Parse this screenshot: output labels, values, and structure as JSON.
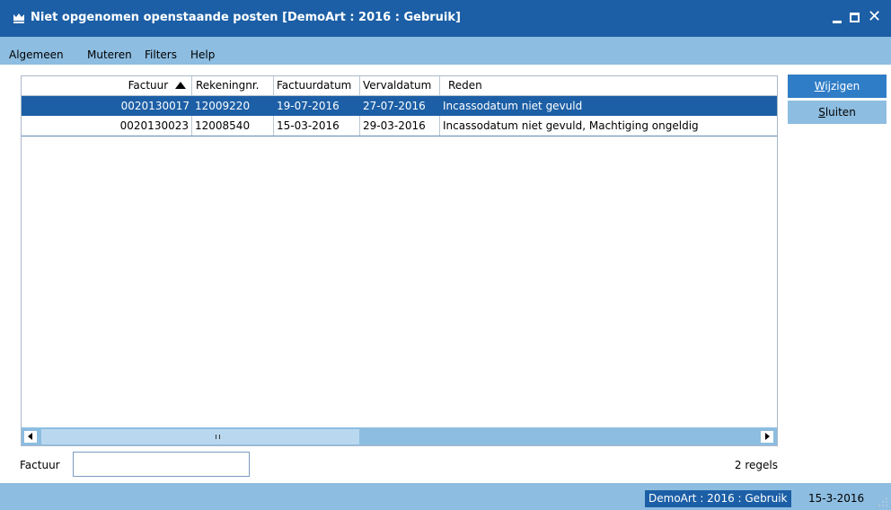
{
  "window": {
    "title": "Niet opgenomen openstaande posten  [DemoArt : 2016 : Gebruik]",
    "controls": [
      "minimize-icon",
      "maximize-icon",
      "close-icon"
    ],
    "close_glyph": "✕"
  },
  "menu": {
    "items": [
      "Algemeen",
      "Muteren",
      "Filters",
      "Help"
    ]
  },
  "grid": {
    "columns": [
      "Factuur",
      "Rekeningnr.",
      "Factuurdatum",
      "Vervaldatum",
      "Reden"
    ],
    "sort_column": "Factuur",
    "sort_direction": "ascending",
    "rows": [
      [
        "0020130017",
        "12009220",
        "19-07-2016",
        "27-07-2016",
        "Incassodatum niet gevuld"
      ],
      [
        "0020130023",
        "12008540",
        "15-03-2016",
        "29-03-2016",
        "Incassodatum niet gevuld, Machtiging ongeldig"
      ]
    ],
    "selected_row": 0
  },
  "buttons": {
    "wijzigen": {
      "first": "W",
      "rest": "ijzigen"
    },
    "sluiten": {
      "first": "S",
      "rest": "luiten"
    }
  },
  "filter": {
    "label": "Factuur",
    "value": "",
    "placeholder": ""
  },
  "row_count": "2 regels",
  "status": {
    "context": "DemoArt : 2016 : Gebruik",
    "date": "15-3-2016"
  },
  "colors": {
    "titlebar": "#1c5fa6",
    "bar_light": "#8dbde0",
    "selection": "#1c5fa6",
    "accent_button": "#2f7dc6"
  }
}
